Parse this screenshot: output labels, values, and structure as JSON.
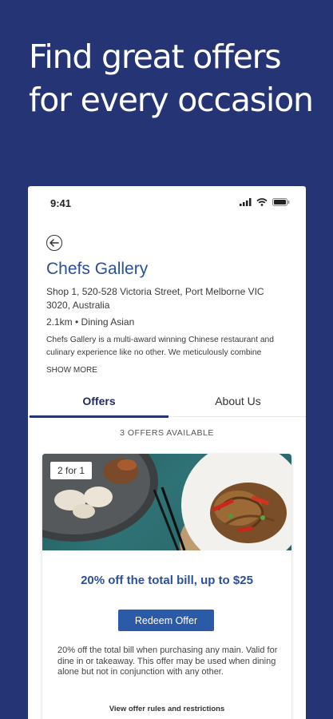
{
  "headline": "Find great offers for every occasion",
  "status_bar": {
    "time": "9:41"
  },
  "restaurant": {
    "name": "Chefs Gallery",
    "address": "Shop 1, 520-528 Victoria Street, Port Melborne VIC 3020, Australia",
    "meta": "2.1km • Dining  Asian",
    "description": "Chefs Gallery is a multi-award winning Chinese restaurant and culinary experience like no other. We meticulously combine",
    "show_more": "SHOW MORE"
  },
  "tabs": [
    {
      "label": "Offers",
      "active": true
    },
    {
      "label": "About Us",
      "active": false
    }
  ],
  "offers_count": "3 OFFERS AVAILABLE",
  "offer": {
    "badge": "2 for 1",
    "title": "20% off the total bill, up to $25",
    "button": "Redeem Offer",
    "text": "20% off the total bill when purchasing any main. Valid for dine in or takeaway. This offer may be used when dining alone but not in conjunction with any other.",
    "rules_link": "View offer rules and restrictions"
  },
  "colors": {
    "navy": "#243474",
    "accent_blue": "#2a4f9c",
    "button_blue": "#2a5aa8"
  }
}
